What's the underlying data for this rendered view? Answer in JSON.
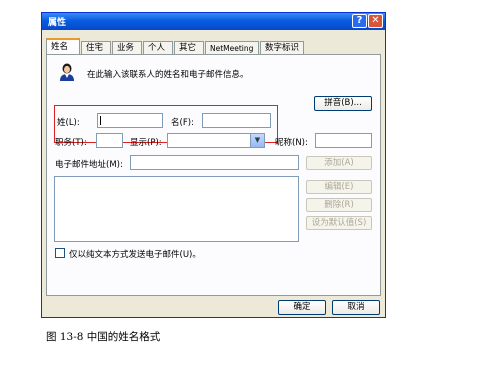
{
  "window": {
    "title": "属性",
    "help_glyph": "?",
    "close_glyph": "✕"
  },
  "tabs": [
    "姓名",
    "住宅",
    "业务",
    "个人",
    "其它",
    "NetMeeting",
    "数字标识"
  ],
  "intro_text": "在此输入该联系人的姓名和电子邮件信息。",
  "buttons": {
    "pinyin": "拼音(B)...",
    "add": "添加(A)",
    "edit": "编辑(E)",
    "delete": "删除(R)",
    "set_default": "设为默认值(S)",
    "ok": "确定",
    "cancel": "取消"
  },
  "fields": {
    "surname_label": "姓(L):",
    "given_label": "名(F):",
    "title_label": "职务(T):",
    "display_label": "显示(P):",
    "nickname_label": "昵称(N):",
    "email_label": "电子邮件地址(M):"
  },
  "checkbox_label": "仅以纯文本方式发送电子邮件(U)。",
  "caption": "图 13-8   中国的姓名格式",
  "icons": {
    "contact": "contact-person-icon",
    "dropdown": "chevron-down-icon"
  }
}
